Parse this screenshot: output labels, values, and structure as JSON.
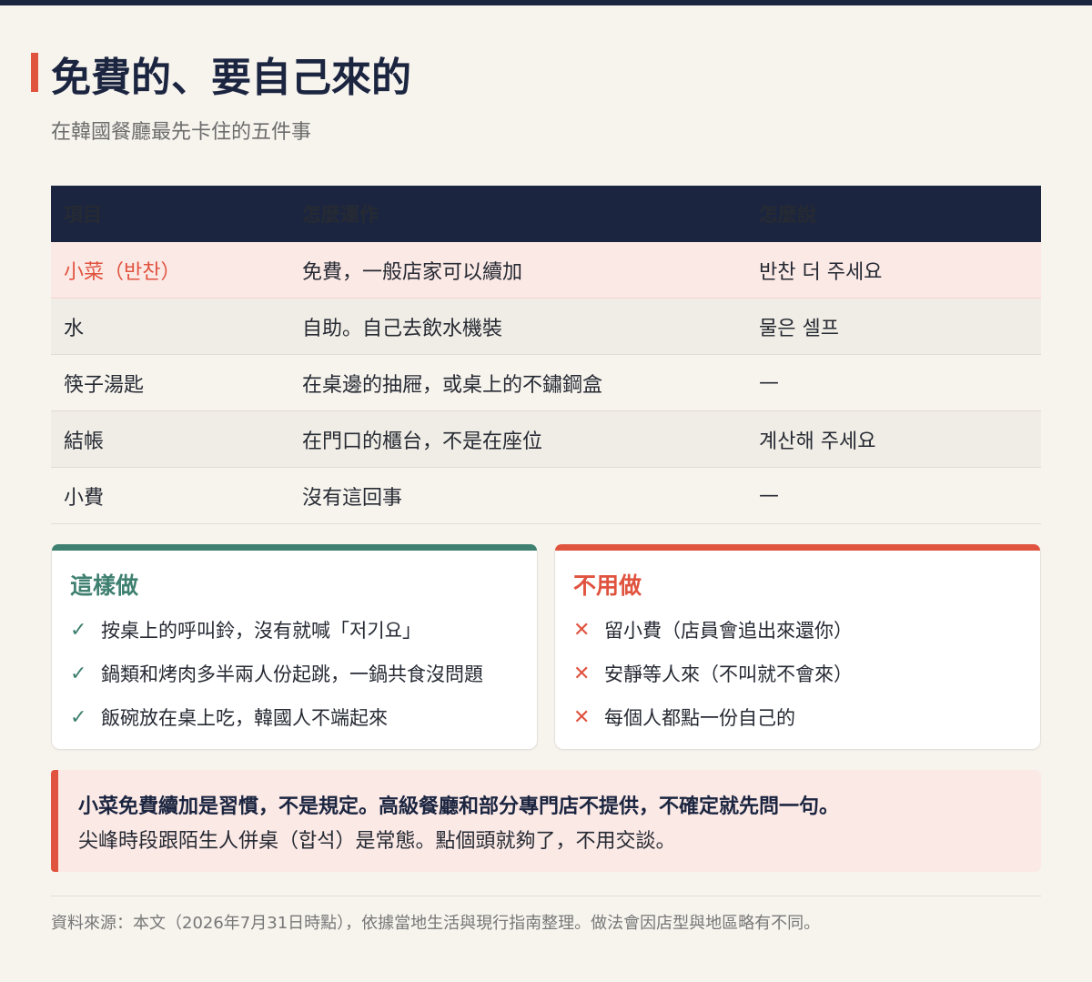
{
  "header": {
    "title": "免費的、要自己來的",
    "subtitle": "在韓國餐廳最先卡住的五件事"
  },
  "table": {
    "columns": [
      "項目",
      "怎麼運作",
      "怎麼說"
    ],
    "rows": [
      [
        "小菜（반찬）",
        "免費，一般店家可以續加",
        "반찬 더 주세요"
      ],
      [
        "水",
        "自助。自己去飲水機裝",
        "물은 셀프"
      ],
      [
        "筷子湯匙",
        "在桌邊的抽屜，或桌上的不鏽鋼盒",
        "—"
      ],
      [
        "結帳",
        "在門口的櫃台，不是在座位",
        "계산해 주세요"
      ],
      [
        "小費",
        "沒有這回事",
        "—"
      ]
    ]
  },
  "do_card": {
    "title": "這樣做",
    "mark": "✓",
    "items": [
      "按桌上的呼叫鈴，沒有就喊「저기요」",
      "鍋類和烤肉多半兩人份起跳，一鍋共食沒問題",
      "飯碗放在桌上吃，韓國人不端起來"
    ]
  },
  "dont_card": {
    "title": "不用做",
    "mark": "✕",
    "items": [
      "留小費（店員會追出來還你）",
      "安靜等人來（不叫就不會來）",
      "每個人都點一份自己的"
    ]
  },
  "note": {
    "line1": "小菜免費續加是習慣，不是規定。高級餐廳和部分專門店不提供，不確定就先問一句。",
    "line2": "尖峰時段跟陌生人併桌（합석）是常態。點個頭就夠了，不用交談。"
  },
  "footer": {
    "source": "資料來源：本文（2026年7月31日時點），依據當地生活與現行指南整理。做法會因店型與地區略有不同。"
  },
  "colors": {
    "navy": "#1b2540",
    "accent_red": "#e0533f",
    "accent_green": "#3f8070",
    "background": "#f7f4ee"
  }
}
